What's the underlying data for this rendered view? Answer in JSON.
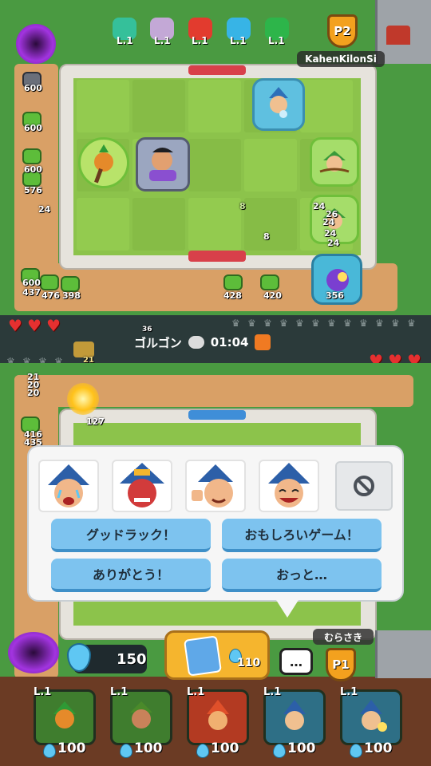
{
  "opponent": {
    "player_tag": "P2",
    "name": "KahenKilonSi",
    "gems": [
      {
        "level": "L.1",
        "color": "#35c09a"
      },
      {
        "level": "L.1",
        "color": "#c3a8d6"
      },
      {
        "level": "L.1",
        "color": "#e23b2e"
      },
      {
        "level": "L.1",
        "color": "#37b4e6"
      },
      {
        "level": "L.1",
        "color": "#2db54a"
      }
    ],
    "enemy_hp": [
      "600",
      "600",
      "600",
      "576",
      "24",
      "600",
      "437",
      "476",
      "398",
      "428",
      "420",
      "356",
      "24",
      "8",
      "8",
      "26",
      "24",
      "24",
      "24"
    ],
    "lives": [
      "♥",
      "♥",
      "♥"
    ]
  },
  "match": {
    "mode_label": "ゴルゴン",
    "timer": "01:04",
    "small_num_a": "36",
    "small_num_b": "21",
    "small_num_c": "24"
  },
  "player": {
    "player_tag": "P1",
    "name": "むらさき",
    "mana": "150",
    "summon_cost": "110",
    "lives": [
      "♥",
      "♥",
      "♥"
    ],
    "enemy_hp": [
      "21",
      "20",
      "20",
      "416",
      "435",
      "127"
    ],
    "deck": [
      {
        "level": "L.1",
        "cost": "100",
        "color": "#3f7d2e"
      },
      {
        "level": "L.1",
        "cost": "100",
        "color": "#3f7d2e"
      },
      {
        "level": "L.1",
        "cost": "100",
        "color": "#b33a22"
      },
      {
        "level": "L.1",
        "cost": "100",
        "color": "#2e6f86"
      },
      {
        "level": "L.1",
        "cost": "100",
        "color": "#2e6f86"
      }
    ]
  },
  "chat": {
    "mute_icon": "ban-icon",
    "phrases": [
      "グッドラック！",
      "おもしろいゲーム！",
      "ありがとう！",
      "おっと…"
    ],
    "chat_icon": "speech-bubble-icon",
    "ellipsis": "…"
  },
  "colors": {
    "grass": "#8cc34b",
    "board_wall": "#e6e3dc",
    "phrase_button": "#7dc3ef",
    "gold_button": "#f5b52e"
  }
}
